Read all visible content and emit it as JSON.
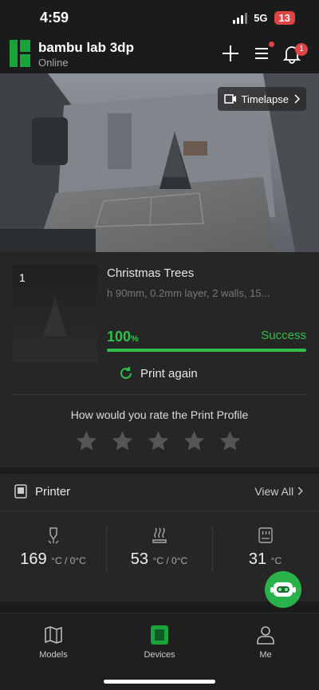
{
  "status_bar": {
    "time": "4:59",
    "network": "5G",
    "battery": "13"
  },
  "header": {
    "printer_name": "bambu lab 3dp",
    "printer_status": "Online",
    "notification_count": "1"
  },
  "camera": {
    "timelapse_label": "Timelapse"
  },
  "job": {
    "index": "1",
    "title": "Christmas Trees",
    "subtitle": "h 90mm, 0.2mm layer, 2 walls, 15...",
    "progress_value": "100",
    "progress_unit": "%",
    "progress": 1.0,
    "status": "Success",
    "print_again_label": "Print again",
    "rate_prompt": "How would you rate the Print Profile",
    "star_count": 5
  },
  "printer_section": {
    "title": "Printer",
    "view_all_label": "View All",
    "temps": [
      {
        "icon": "nozzle-icon",
        "value": "169",
        "unit": "°C / 0°C"
      },
      {
        "icon": "heatbed-icon",
        "value": "53",
        "unit": "°C / 0°C"
      },
      {
        "icon": "chamber-icon",
        "value": "31",
        "unit": "°C"
      }
    ]
  },
  "tabbar": {
    "tabs": [
      {
        "label": "Models",
        "icon": "models-icon"
      },
      {
        "label": "Devices",
        "icon": "devices-icon",
        "active": true
      },
      {
        "label": "Me",
        "icon": "person-icon"
      }
    ]
  },
  "colors": {
    "accent": "#2ec04a",
    "brand": "#1aa33a",
    "alert": "#e04545",
    "background": "#1b1b1b",
    "card": "#262626"
  }
}
